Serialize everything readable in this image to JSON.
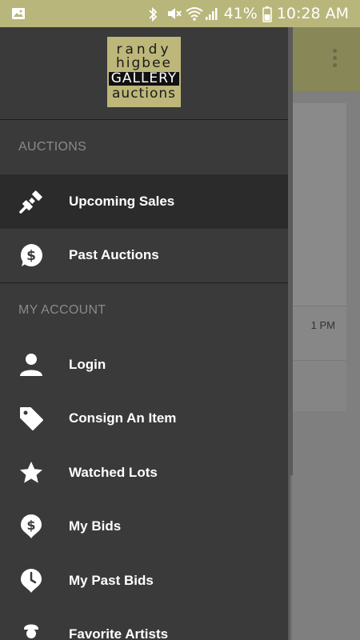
{
  "status_bar": {
    "battery": "41%",
    "time": "10:28 AM",
    "icons": [
      "image-icon",
      "bluetooth-icon",
      "mute-icon",
      "wifi-icon",
      "signal-icon",
      "battery-icon"
    ]
  },
  "logo": {
    "line1": "randy",
    "line2": "higbee",
    "line3": "GALLERY",
    "line4": "auctions"
  },
  "sections": {
    "auctions_header": "AUCTIONS",
    "account_header": "MY ACCOUNT"
  },
  "menu": {
    "auctions": [
      {
        "label": "Upcoming Sales",
        "icon": "gavel-icon",
        "active": true
      },
      {
        "label": "Past Auctions",
        "icon": "dollar-bubble-icon"
      }
    ],
    "account": [
      {
        "label": "Login",
        "icon": "person-icon"
      },
      {
        "label": "Consign An Item",
        "icon": "tag-icon"
      },
      {
        "label": "Watched Lots",
        "icon": "star-icon"
      },
      {
        "label": "My Bids",
        "icon": "dollar-bubble-icon"
      },
      {
        "label": "My Past Bids",
        "icon": "clock-bubble-icon"
      },
      {
        "label": "Favorite Artists",
        "icon": "artist-icon"
      }
    ]
  },
  "background": {
    "time_text": "1 PM"
  },
  "colors": {
    "status_bar": "#b9b67c",
    "drawer_bg": "#3a3a3a",
    "active_item_bg": "#2b2b2b",
    "logo_bg": "#bdb77a"
  }
}
